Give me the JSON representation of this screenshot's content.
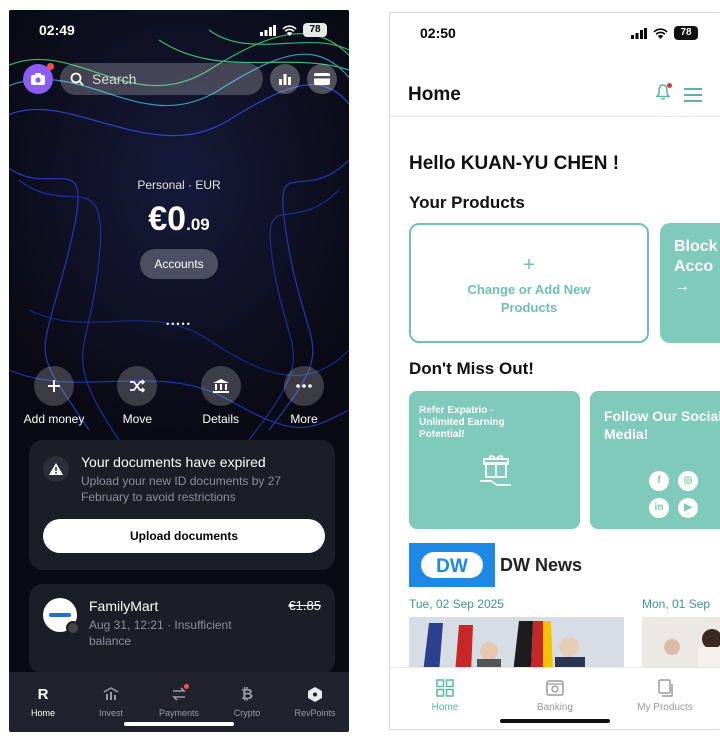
{
  "left": {
    "status": {
      "time": "02:49",
      "battery": "78"
    },
    "search": {
      "placeholder": "Search"
    },
    "account": {
      "label": "Personal · EUR",
      "balance_main": "€0",
      "balance_cents": ".09",
      "accounts_button": "Accounts"
    },
    "pager_dots": "•••••",
    "actions": [
      {
        "label": "Add money",
        "icon": "plus-icon"
      },
      {
        "label": "Move",
        "icon": "shuffle-icon"
      },
      {
        "label": "Details",
        "icon": "bank-icon"
      },
      {
        "label": "More",
        "icon": "ellipsis-icon"
      }
    ],
    "documents": {
      "title": "Your documents have expired",
      "subtitle": "Upload your new ID documents by 27 February to avoid restrictions",
      "button": "Upload documents"
    },
    "transaction": {
      "merchant": "FamilyMart",
      "meta": "Aug 31, 12:21 · Insufficient balance",
      "amount": "€1.85"
    },
    "nav": [
      {
        "label": "Home",
        "icon": "R"
      },
      {
        "label": "Invest",
        "icon": "invest-icon"
      },
      {
        "label": "Payments",
        "icon": "transfer-icon"
      },
      {
        "label": "Crypto",
        "icon": "₿"
      },
      {
        "label": "RevPoints",
        "icon": "hexagon-icon"
      }
    ]
  },
  "right": {
    "status": {
      "time": "02:50",
      "battery": "78"
    },
    "header": {
      "title": "Home"
    },
    "greeting": "Hello KUAN-YU CHEN !",
    "products": {
      "title": "Your Products",
      "add_plus": "+",
      "add_label": "Change or Add New Products",
      "blocked_label_1": "Block",
      "blocked_label_2": "Acco",
      "blocked_arrow": "→"
    },
    "promo": {
      "title": "Don't Miss Out!",
      "refer": "Refer Expatrio - Unlimited Earning Potential!",
      "social": "Follow Our Social Media!",
      "social_icons": [
        "f",
        "◎",
        "in",
        "▶"
      ]
    },
    "news": {
      "source_logo": "DW",
      "title": "DW News",
      "dates": [
        "Tue, 02 Sep 2025",
        "Mon, 01 Sep"
      ]
    },
    "nav": [
      {
        "label": "Home",
        "icon": "grid-icon"
      },
      {
        "label": "Banking",
        "icon": "safe-icon"
      },
      {
        "label": "My Products",
        "icon": "copy-icon"
      }
    ],
    "colors": {
      "accent": "#7fcabb",
      "nav_active": "#5bb5a4"
    }
  }
}
